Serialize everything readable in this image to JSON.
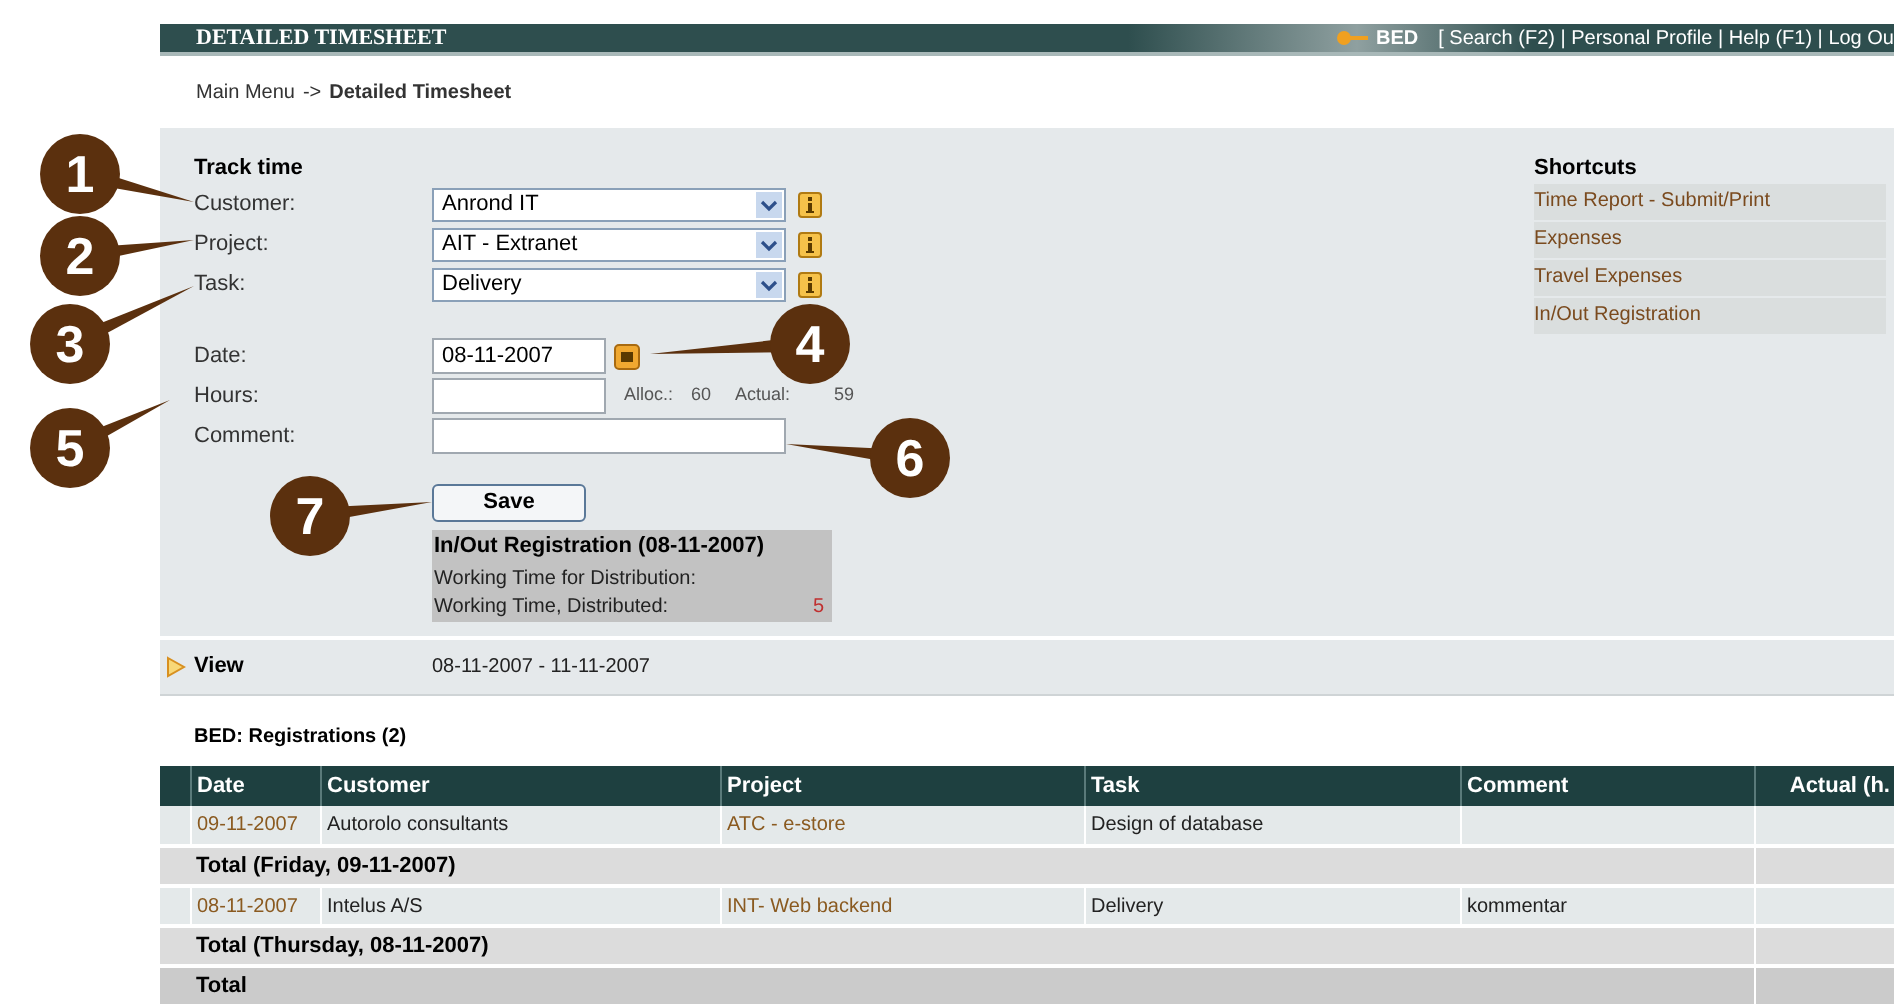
{
  "header": {
    "title": "DETAILED TIMESHEET",
    "user": "BED",
    "links": "[ Search (F2) | Personal Profile | Help (F1) | Log Ou"
  },
  "breadcrumb": {
    "items": [
      "Main Menu",
      "Detailed Timesheet"
    ],
    "separator": "->"
  },
  "form": {
    "title": "Track time",
    "fields": [
      {
        "kind": "select",
        "label": "Customer:",
        "value": "Anrond IT"
      },
      {
        "kind": "select",
        "label": "Project:",
        "value": "AIT - Extranet"
      },
      {
        "kind": "select",
        "label": "Task:",
        "value": "Delivery"
      },
      {
        "kind": "date",
        "label": "Date:",
        "value": "08-11-2007"
      },
      {
        "kind": "hours",
        "label": "Hours:",
        "alloc_label": "Alloc.:",
        "alloc": "60",
        "actual_label": "Actual:",
        "actual": "59"
      },
      {
        "kind": "text",
        "label": "Comment:"
      }
    ],
    "save": "Save",
    "inout": {
      "title": "In/Out Registration (08-11-2007)",
      "rows": [
        {
          "label": "Working Time for Distribution:"
        },
        {
          "label": "Working Time, Distributed:",
          "value": "5"
        }
      ]
    }
  },
  "shortcuts": {
    "title": "Shortcuts",
    "items": [
      "Time Report - Submit/Print",
      "Expenses",
      "Travel Expenses",
      "In/Out Registration"
    ]
  },
  "view": {
    "label": "View",
    "value": "08-11-2007 - 11-11-2007"
  },
  "registrations": {
    "title": "BED: Registrations (2)",
    "columns": [
      "Date",
      "Customer",
      "Project",
      "Task",
      "Comment",
      "Actual (h."
    ],
    "rows": [
      {
        "kind": "entry",
        "cells": [
          "09-11-2007",
          "Autorolo consultants",
          "ATC - e-store",
          "Design of database",
          ""
        ]
      },
      {
        "kind": "total",
        "label": "Total (Friday, 09-11-2007)"
      },
      {
        "kind": "entry",
        "cells": [
          "08-11-2007",
          "Intelus A/S",
          "INT- Web backend",
          "Delivery",
          "kommentar"
        ]
      },
      {
        "kind": "total",
        "label": "Total (Thursday, 08-11-2007)"
      },
      {
        "kind": "grand",
        "label": "Total"
      }
    ]
  },
  "callouts": [
    {
      "label": "1"
    },
    {
      "label": "2"
    },
    {
      "label": "3"
    },
    {
      "label": "4"
    },
    {
      "label": "5"
    },
    {
      "label": "6"
    },
    {
      "label": "7"
    }
  ]
}
